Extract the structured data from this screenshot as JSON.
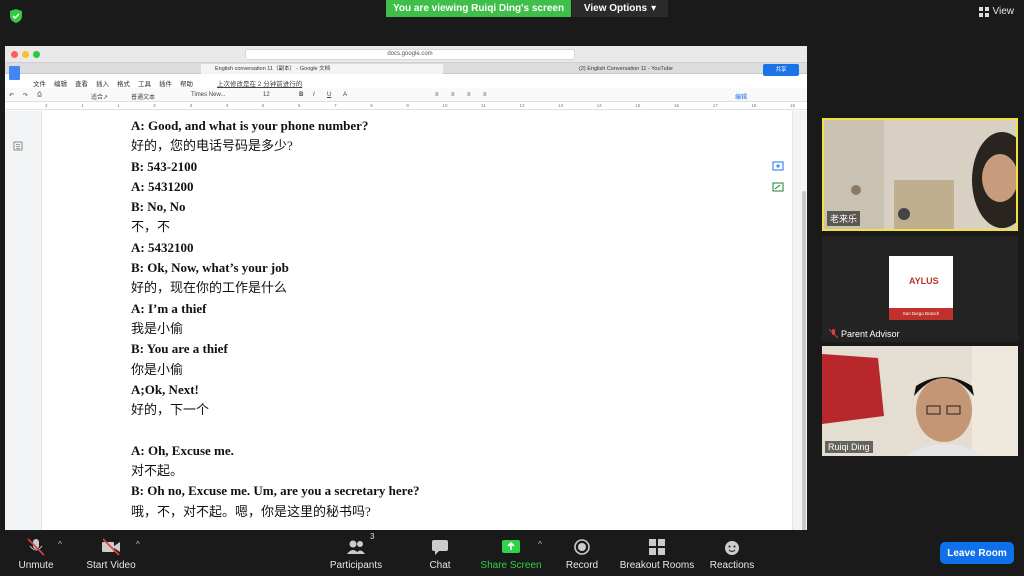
{
  "top": {
    "banner": "You are viewing Ruiqi Ding's screen",
    "view_options": "View Options",
    "view": "View"
  },
  "browser": {
    "url": "docs.google.com",
    "tab1": "English conversation 11（副本） - Google 文档",
    "tab2": "(2) English Conversation 11 - YouTube",
    "menu": [
      "文件",
      "编辑",
      "查看",
      "插入",
      "格式",
      "工具",
      "插件",
      "帮助"
    ],
    "last_edit": "上次修改是在 2 分钟前进行的",
    "share": "共享",
    "toolbar": {
      "zoom": "适合↗",
      "style": "普通文本",
      "font": "Times New...",
      "size": "12",
      "mode": "编辑"
    },
    "ruler": [
      "2",
      "1",
      "1",
      "2",
      "3",
      "4",
      "5",
      "6",
      "7",
      "8",
      "9",
      "10",
      "11",
      "12",
      "13",
      "14",
      "15",
      "16",
      "17",
      "18",
      "19"
    ]
  },
  "doc": {
    "lines": [
      {
        "t": "A: Good, and what is your phone number?",
        "b": true
      },
      {
        "t": "好的，您的电话号码是多少?",
        "b": false
      },
      {
        "t": "B: 543-2100",
        "b": true
      },
      {
        "t": "A: 5431200",
        "b": true
      },
      {
        "t": "B: No, No",
        "b": true
      },
      {
        "t": "不，不",
        "b": false
      },
      {
        "t": "A: 5432100",
        "b": true
      },
      {
        "t": "B: Ok, Now, what’s your job",
        "b": true
      },
      {
        "t": "好的，现在你的工作是什么",
        "b": false
      },
      {
        "t": "A: I’m a thief",
        "b": true
      },
      {
        "t": "我是小偷",
        "b": false
      },
      {
        "t": "B: You are a thief",
        "b": true
      },
      {
        "t": "你是小偷",
        "b": false
      },
      {
        "t": "A;Ok, Next!",
        "b": true
      },
      {
        "t": "好的，下一个",
        "b": false
      },
      {
        "t": " ",
        "b": false
      },
      {
        "t": "A: Oh, Excuse me.",
        "b": true
      },
      {
        "t": "对不起。",
        "b": false
      },
      {
        "t": "B: Oh no, Excuse me. Um, are you a secretary here?",
        "b": true
      },
      {
        "t": "哦，不，对不起。嗯，你是这里的秘书吗?",
        "b": false
      }
    ]
  },
  "participants_panel": {
    "p1": "老来乐",
    "p2": "Parent Advisor",
    "p2_logo": "AYLUS",
    "p2_logo_sub": "San Diego Branch",
    "p3": "Ruiqi Ding"
  },
  "zoom_toolbar": {
    "unmute": "Unmute",
    "start_video": "Start Video",
    "participants": "Participants",
    "participant_count": "3",
    "chat": "Chat",
    "share_screen": "Share Screen",
    "record": "Record",
    "breakout": "Breakout Rooms",
    "reactions": "Reactions",
    "leave": "Leave Room"
  },
  "colors": {
    "green": "#3fbf4a",
    "blue": "#0e71eb",
    "highlight": "#f2e240"
  }
}
